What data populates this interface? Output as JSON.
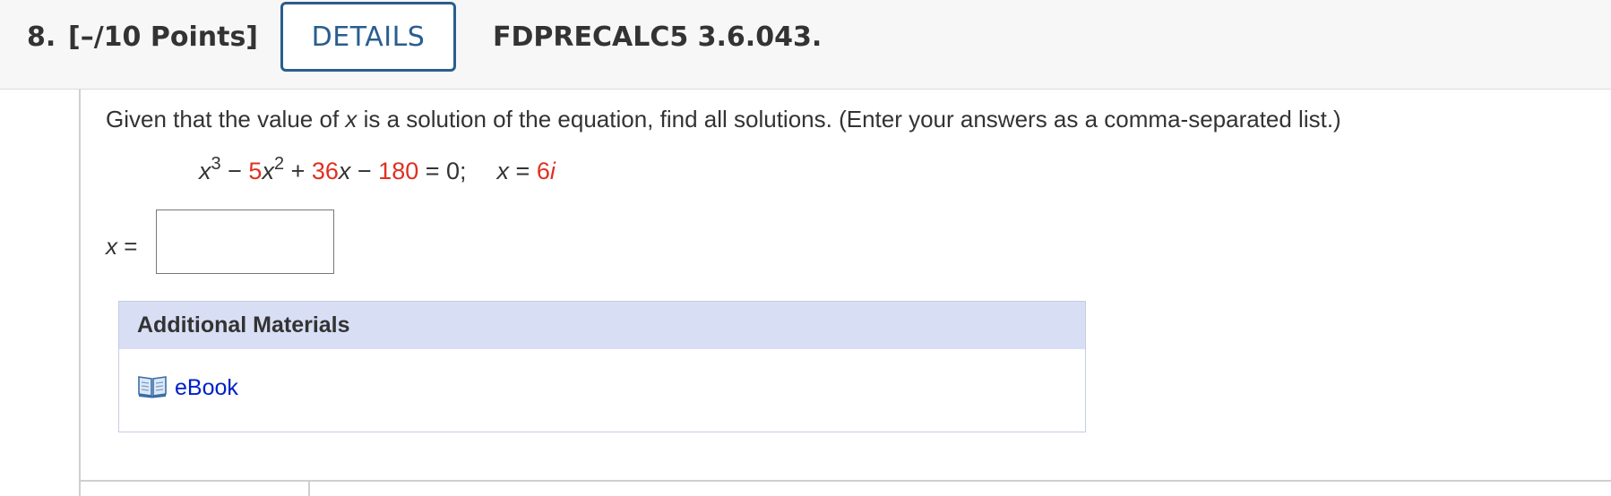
{
  "header": {
    "question_number": "8.",
    "points": "[–/10 Points]",
    "details_label": "DETAILS",
    "problem_code": "FDPRECALC5 3.6.043."
  },
  "question": {
    "prompt_before_var": "Given that the value of ",
    "prompt_var": "x",
    "prompt_after_var": " is a solution of the equation, find all solutions. (Enter your answers as a comma-separated list.)",
    "equation": {
      "t1_base": "x",
      "t1_exp": "3",
      "op1": " − ",
      "t2_coef": "5",
      "t2_base": "x",
      "t2_exp": "2",
      "op2": " + ",
      "t3_coef": "36",
      "t3_base": "x",
      "op3": " − ",
      "t4_const": "180",
      "equals_zero": " = 0;",
      "given_var": "x",
      "given_eq": " = ",
      "given_coef": "6",
      "given_imag": "i"
    },
    "answer_var": "x",
    "answer_eq": " =",
    "answer_value": ""
  },
  "additional_materials": {
    "title": "Additional Materials",
    "items": [
      {
        "label": "eBook",
        "icon": "ebook-icon"
      }
    ]
  },
  "colors": {
    "accent_blue": "#2a5d8f",
    "highlight_red": "#e03020",
    "link_blue": "#0020c8",
    "materials_header_bg": "#d8def4"
  }
}
